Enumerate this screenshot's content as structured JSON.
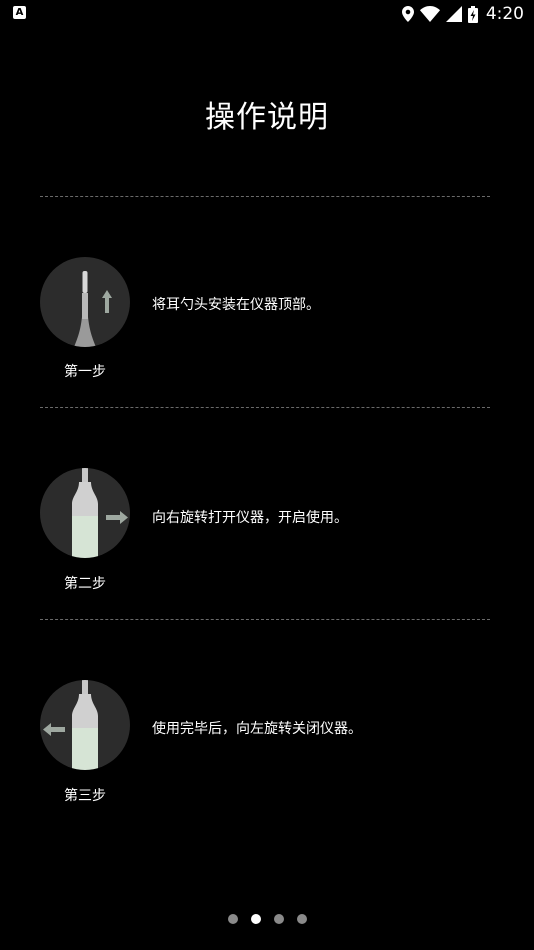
{
  "status_bar": {
    "notification_icon": "a-icon",
    "time": "4:20",
    "icons": [
      "location-icon",
      "wifi-icon",
      "signal-icon",
      "battery-charging-icon"
    ]
  },
  "title": "操作说明",
  "steps": [
    {
      "label": "第一步",
      "description": "将耳勺头安装在仪器顶部。",
      "image": "device-attach-earpick"
    },
    {
      "label": "第二步",
      "description": "向右旋转打开仪器，开启使用。",
      "image": "device-rotate-right"
    },
    {
      "label": "第三步",
      "description": "使用完毕后，向左旋转关闭仪器。",
      "image": "device-rotate-left"
    }
  ],
  "pager": {
    "count": 4,
    "active_index": 1
  },
  "colors": {
    "background": "#000000",
    "circle": "#2c2c2c",
    "device_body": "#cfe0cf",
    "divider": "#6a6a6a"
  }
}
